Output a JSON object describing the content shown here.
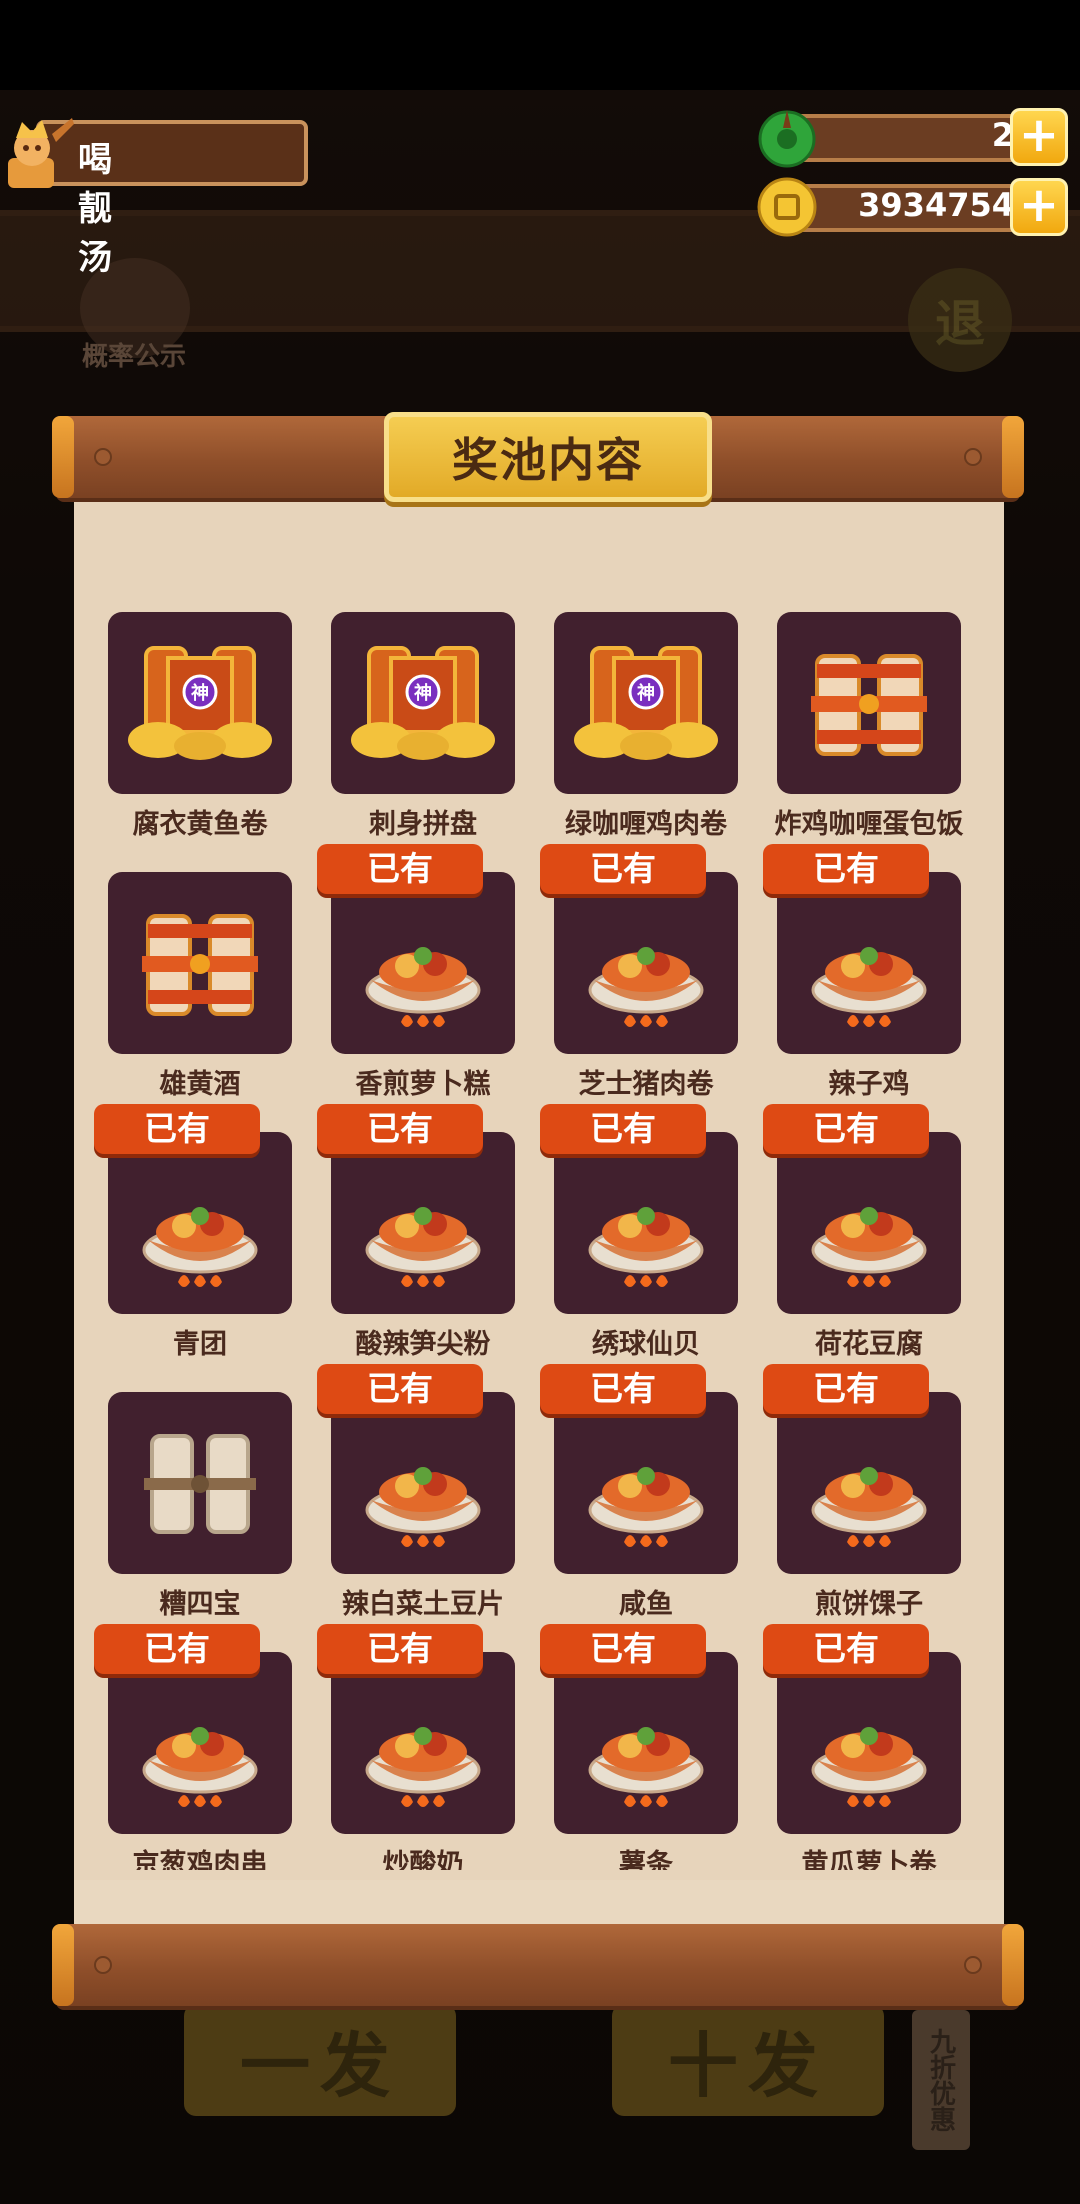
{
  "header": {
    "player_name": "喝靓汤",
    "jade": "2",
    "coins": "3934754",
    "plus": "+"
  },
  "background": {
    "odds_label": "概率公示",
    "exit_label": "退",
    "draw_one_label": "一发",
    "draw_ten_label": "十发",
    "discount_label": "九折优惠"
  },
  "modal": {
    "title": "奖池内容",
    "owned_label": "已有",
    "items": [
      {
        "name": "腐衣黄鱼卷",
        "art": "gold-chest",
        "owned": false
      },
      {
        "name": "刺身拼盘",
        "art": "gold-chest",
        "owned": false
      },
      {
        "name": "绿咖喱鸡肉卷",
        "art": "gold-chest",
        "owned": false
      },
      {
        "name": "炸鸡咖喱蛋包饭",
        "art": "red-scroll",
        "owned": false
      },
      {
        "name": "雄黄酒",
        "art": "red-scroll",
        "owned": false
      },
      {
        "name": "香煎萝卜糕",
        "art": "dish",
        "owned": true
      },
      {
        "name": "芝士猪肉卷",
        "art": "dish",
        "owned": true
      },
      {
        "name": "辣子鸡",
        "art": "dish",
        "owned": true
      },
      {
        "name": "青团",
        "art": "dish",
        "owned": true
      },
      {
        "name": "酸辣笋尖粉",
        "art": "dish",
        "owned": true
      },
      {
        "name": "绣球仙贝",
        "art": "dish",
        "owned": true
      },
      {
        "name": "荷花豆腐",
        "art": "dish",
        "owned": true
      },
      {
        "name": "糟四宝",
        "art": "plain-scroll",
        "owned": false
      },
      {
        "name": "辣白菜土豆片",
        "art": "dish",
        "owned": true
      },
      {
        "name": "咸鱼",
        "art": "dish",
        "owned": true
      },
      {
        "name": "煎饼馃子",
        "art": "dish",
        "owned": true
      },
      {
        "name": "京葱鸡肉串",
        "art": "dish",
        "owned": true
      },
      {
        "name": "炒酸奶",
        "art": "dish",
        "owned": true
      },
      {
        "name": "薯条",
        "art": "dish",
        "owned": true
      },
      {
        "name": "黄瓜萝卜卷",
        "art": "dish",
        "owned": true
      }
    ]
  },
  "colors": {
    "card_bg": "#41202e",
    "owned_badge": "#de4a14",
    "title_plate": "#e2aa27",
    "parchment": "#e7d4bb"
  }
}
